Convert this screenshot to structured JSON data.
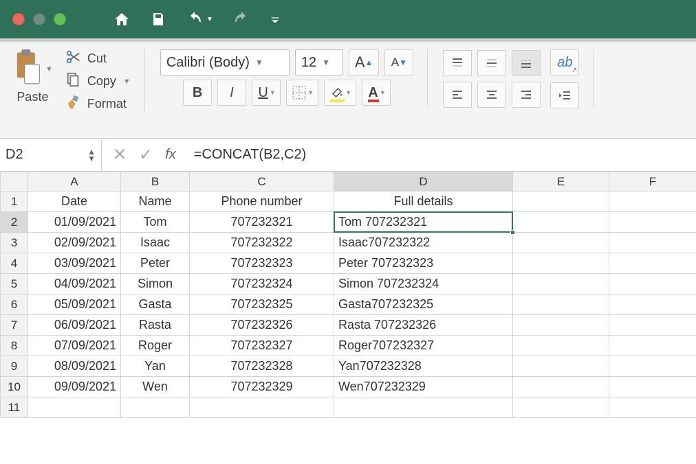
{
  "titlebar": {
    "icons": [
      "home",
      "save",
      "undo",
      "redo",
      "more"
    ]
  },
  "ribbon": {
    "paste_label": "Paste",
    "cut_label": "Cut",
    "copy_label": "Copy",
    "format_label": "Format",
    "font_name": "Calibri (Body)",
    "font_size": "12",
    "increase_font": "A",
    "decrease_font": "A",
    "bold": "B",
    "italic": "I",
    "underline": "U",
    "font_color_letter": "A"
  },
  "namebox": {
    "value": "D2"
  },
  "formula": {
    "value": "=CONCAT(B2,C2)",
    "fx_label": "fx"
  },
  "columns": [
    "A",
    "B",
    "C",
    "D",
    "E",
    "F"
  ],
  "headers": {
    "A": "Date",
    "B": "Name",
    "C": "Phone number",
    "D": "Full details"
  },
  "selected_col": "D",
  "selected_row": "2",
  "rows": [
    {
      "n": "1"
    },
    {
      "n": "2",
      "A": "01/09/2021",
      "B": "Tom",
      "C": "707232321",
      "D": "Tom 707232321"
    },
    {
      "n": "3",
      "A": "02/09/2021",
      "B": "Isaac",
      "C": "707232322",
      "D": "Isaac707232322"
    },
    {
      "n": "4",
      "A": "03/09/2021",
      "B": "Peter",
      "C": "707232323",
      "D": "Peter 707232323"
    },
    {
      "n": "5",
      "A": "04/09/2021",
      "B": "Simon",
      "C": "707232324",
      "D": "Simon 707232324"
    },
    {
      "n": "6",
      "A": "05/09/2021",
      "B": "Gasta",
      "C": "707232325",
      "D": "Gasta707232325"
    },
    {
      "n": "7",
      "A": "06/09/2021",
      "B": "Rasta",
      "C": "707232326",
      "D": "Rasta 707232326"
    },
    {
      "n": "8",
      "A": "07/09/2021",
      "B": "Roger",
      "C": "707232327",
      "D": "Roger707232327"
    },
    {
      "n": "9",
      "A": "08/09/2021",
      "B": "Yan",
      "C": "707232328",
      "D": "Yan707232328"
    },
    {
      "n": "10",
      "A": "09/09/2021",
      "B": "Wen",
      "C": "707232329",
      "D": "Wen707232329"
    },
    {
      "n": "11"
    }
  ]
}
